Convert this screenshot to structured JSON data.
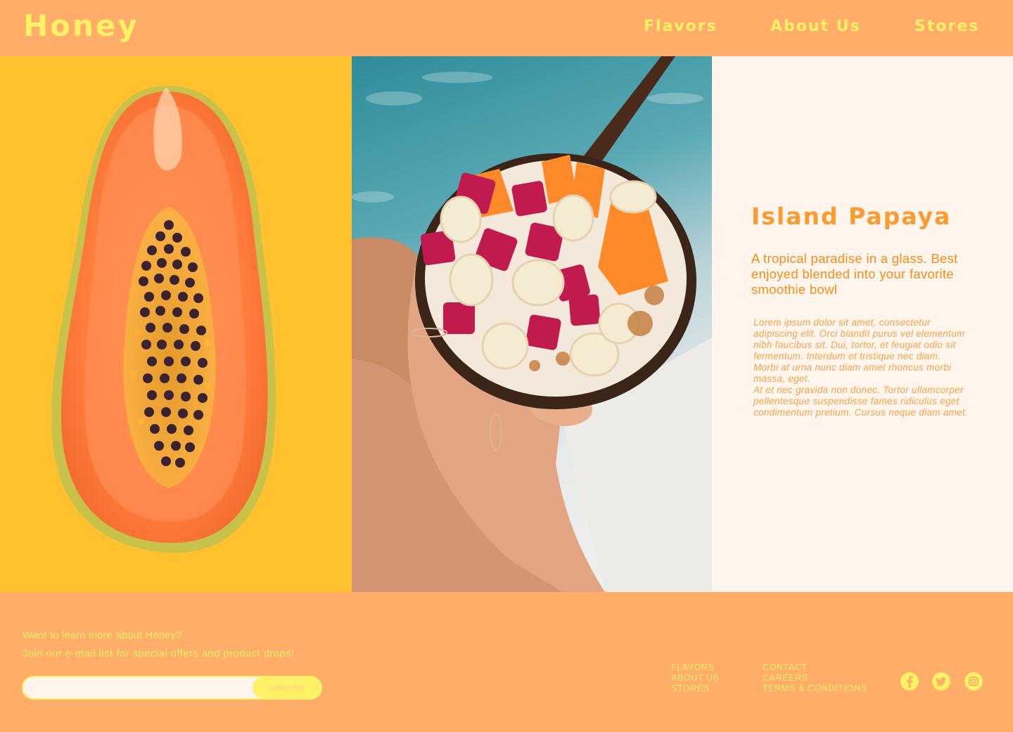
{
  "header": {
    "logo": "Honey",
    "nav": [
      {
        "label": "Flavors"
      },
      {
        "label": "About Us"
      },
      {
        "label": "Stores"
      }
    ]
  },
  "product": {
    "title": "Island Papaya",
    "tagline": "A tropical paradise in a glass. Best enjoyed blended into your favorite smoothie bowl",
    "body": [
      "Lorem ipsum dolor sit amet, consectetur adipiscing elit. Orci blandit purus vel elementum nibh faucibus sit. Dui, tortor, et feugiat odio sit fermentum. Interdum et tristique nec diam.",
      "Morbi at urna nunc diam amet rhoncus morbi massa, eget.",
      "At et nec gravida non donec. Tortor ullamcorper pellentesque suspendisse fames ridiculus eget condimentum pretium. Cursus neque diam amet."
    ]
  },
  "footer": {
    "heading": "Want to learn more about Honey?",
    "subheading": "Join our e-mail list for special offers and product drops!",
    "email_placeholder": "",
    "subscribe_label": "subscribe",
    "links_col1": [
      "FLAVORS",
      "ABOUT US",
      "STORES"
    ],
    "links_col2": [
      "CONTACT",
      "CAREERS",
      "TERMS & CONDITIONS"
    ],
    "social": [
      "facebook-icon",
      "twitter-icon",
      "instagram-icon"
    ]
  },
  "colors": {
    "brand_orange": "#FFAD69",
    "brand_yellow": "#FFF165",
    "accent_text": "#FF9A2E",
    "panel_cream": "#FFF5EC",
    "papaya_bg": "#FFC22E"
  }
}
